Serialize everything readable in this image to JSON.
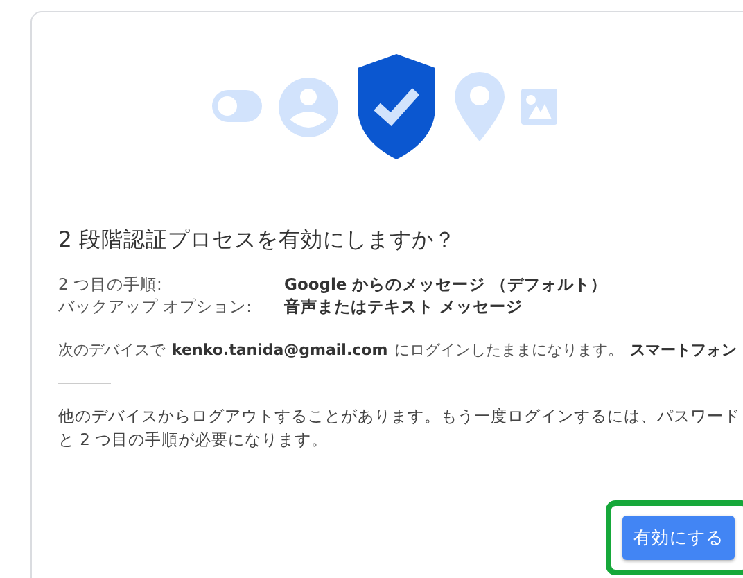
{
  "dialog": {
    "title": "2 段階認証プロセスを有効にしますか？",
    "details": [
      {
        "label": "2 つ目の手順:",
        "value": "Google からのメッセージ （デフォルト）"
      },
      {
        "label": "バックアップ オプション:",
        "value": "音声またはテキスト メッセージ"
      }
    ],
    "device_notice": {
      "prefix": "次のデバイスで",
      "email": "kenko.tanida@gmail.com",
      "suffix": "にログインしたままになります。",
      "device": "スマートフォン"
    },
    "warning": "他のデバイスからログアウトすることがあります。もう一度ログインするには、パスワードと 2 つ目の手順が必要になります。",
    "button": {
      "label": "有効にする",
      "highlighted": true
    }
  }
}
